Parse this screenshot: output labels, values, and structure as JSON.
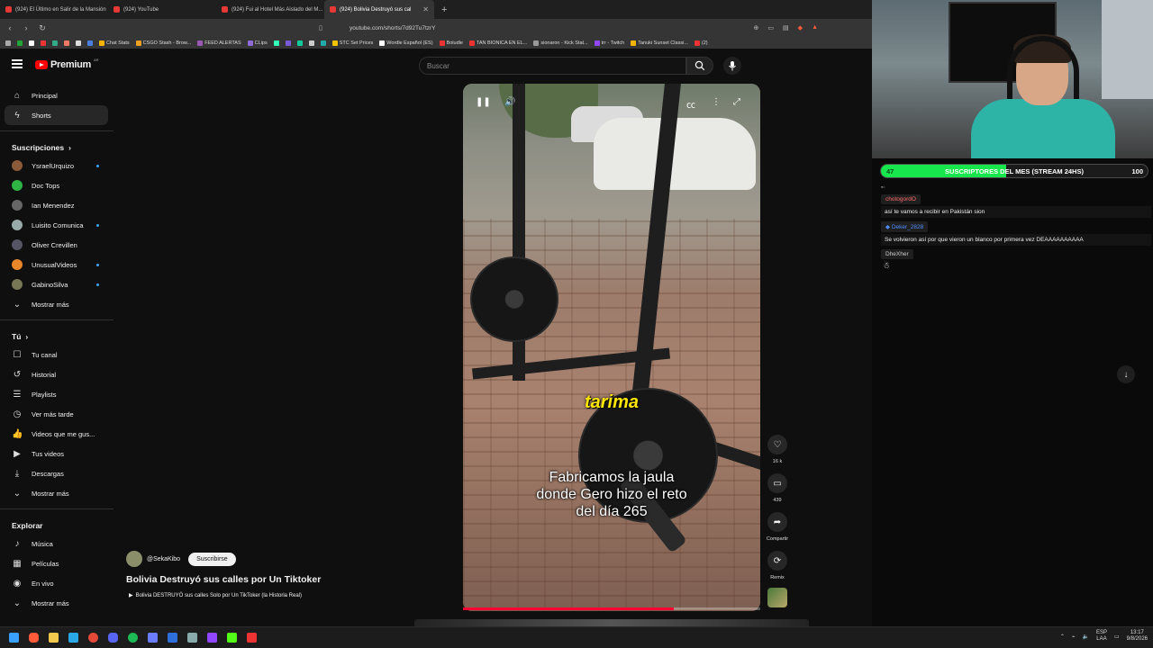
{
  "browser": {
    "tabs": [
      {
        "label": "(924) El Último en Salir de la Mansión",
        "active": false
      },
      {
        "label": "(924) YouTube",
        "active": false
      },
      {
        "label": "(924) Fui al Hotel Más Aislado del M...",
        "active": false
      },
      {
        "label": "(924) Bolivia Destruyó sus cal",
        "active": true
      }
    ],
    "url": "youtube.com/shorts/7d92Tu7tzrY",
    "bookmarks": [
      "Chat Stats",
      "CSGO Stash - Brow...",
      "FEED ALERTAS",
      "CLips",
      "STC Set Prices",
      "Wordle Español (ES)",
      "Boludle",
      "TAN BIONICA EN EL...",
      "sionaron - Kick Stat...",
      "trr - Twitch",
      "Tanuki Sunset Classi...",
      "(2)"
    ]
  },
  "youtube": {
    "logo_text": "Premium",
    "logo_badge": "AR",
    "search_placeholder": "Buscar",
    "sidebar": {
      "main": [
        {
          "label": "Principal",
          "icon": "home-icon"
        },
        {
          "label": "Shorts",
          "icon": "shorts-icon",
          "active": true
        }
      ],
      "subs_header": "Suscripciones",
      "subscriptions": [
        {
          "label": "YsraelUrquizo",
          "dot": true,
          "color": "#8a5a3a"
        },
        {
          "label": "Doc Tops",
          "dot": false,
          "color": "#2fb344"
        },
        {
          "label": "Ian Menendez",
          "dot": false,
          "color": "#666"
        },
        {
          "label": "Luisito Comunica",
          "dot": true,
          "color": "#9aa"
        },
        {
          "label": "Oliver Crevillen",
          "dot": false,
          "color": "#556"
        },
        {
          "label": "UnusualVideos",
          "dot": true,
          "color": "#e8872a"
        },
        {
          "label": "GabinoSilva",
          "dot": true,
          "color": "#775"
        }
      ],
      "subs_more": "Mostrar más",
      "you_header": "Tú",
      "you": [
        {
          "label": "Tu canal",
          "icon": "channel-icon"
        },
        {
          "label": "Historial",
          "icon": "history-icon"
        },
        {
          "label": "Playlists",
          "icon": "playlists-icon"
        },
        {
          "label": "Ver más tarde",
          "icon": "watch-later-icon"
        },
        {
          "label": "Videos que me gus...",
          "icon": "liked-icon"
        },
        {
          "label": "Tus videos",
          "icon": "your-videos-icon"
        },
        {
          "label": "Descargas",
          "icon": "downloads-icon"
        }
      ],
      "you_more": "Mostrar más",
      "explore_header": "Explorar",
      "explore": [
        {
          "label": "Música",
          "icon": "music-icon"
        },
        {
          "label": "Películas",
          "icon": "movies-icon"
        },
        {
          "label": "En vivo",
          "icon": "live-icon"
        }
      ],
      "explore_more": "Mostrar más"
    },
    "short": {
      "overlay_word": "tarima",
      "caption": "Fabricamos la jaula donde Gero hizo el reto del día 265",
      "progress": 0.71,
      "actions": {
        "likes": "16 k",
        "comments": "439",
        "share": "Compartir",
        "remix": "Remix"
      },
      "channel": "@SekaKibo",
      "subscribe": "Suscribirse",
      "title": "Bolivia Destruyó sus calles por Un Tiktoker",
      "linked_video": "Bolivia DESTRUYÓ sus calles Solo por Un TikToker (la Historia Real)"
    }
  },
  "stream": {
    "goal": {
      "current": "47",
      "label": "SUSCRIPTORES DEL MES (STREAM 24HS)",
      "target": "100",
      "fraction": 0.47
    },
    "chat": [
      {
        "user": "chotogordO",
        "user_color": "#ff6b6b",
        "text": "así te vamos a recibir en Pakistán sion"
      },
      {
        "user": "Deker_2828",
        "user_color": "#4f8cff",
        "text": "Se volvieron así por que vieron un blanco por primera vez DEAAAAAAAAAA"
      },
      {
        "user": "DheXher",
        "user_color": "#cfcfcf",
        "text": ""
      }
    ]
  },
  "taskbar": {
    "lang_top": "ESP",
    "lang_bottom": "LAA",
    "time": "13:17",
    "date": "9/8/2026"
  }
}
